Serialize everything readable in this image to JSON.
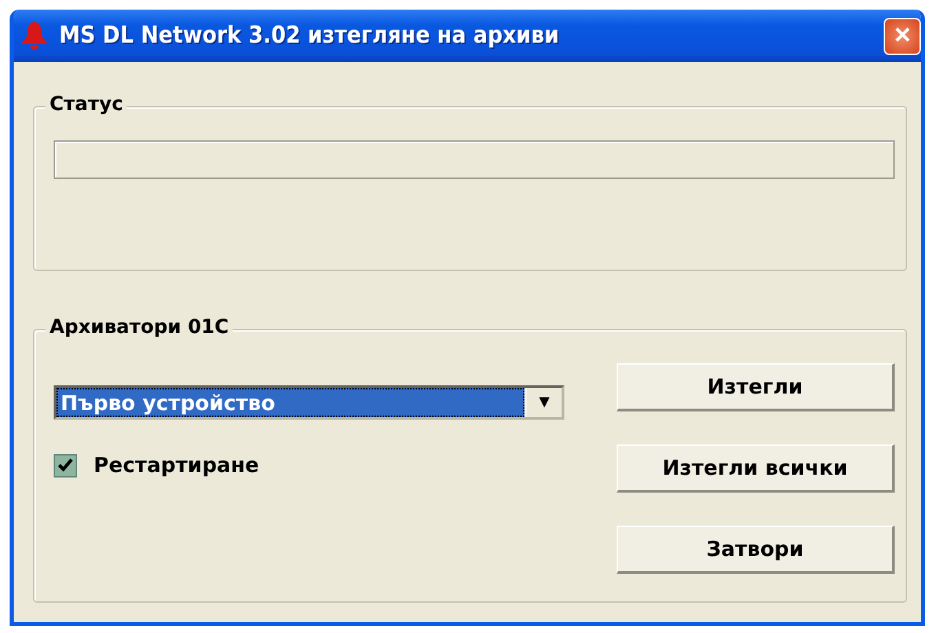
{
  "window": {
    "title": "MS DL Network 3.02 изтегляне на архиви",
    "close": "✕"
  },
  "status_group": {
    "label": "Статус",
    "progress": {
      "level": 0
    }
  },
  "archivers_group": {
    "label": "Архиватори 01С",
    "device_dropdown": {
      "value": "Първо устройство",
      "arrow": "▼"
    },
    "restart_checkbox": {
      "label": "Рестартиране",
      "checked": true
    },
    "buttons": [
      "Изтегли",
      "Изтегли всички",
      "Затвори"
    ]
  }
}
